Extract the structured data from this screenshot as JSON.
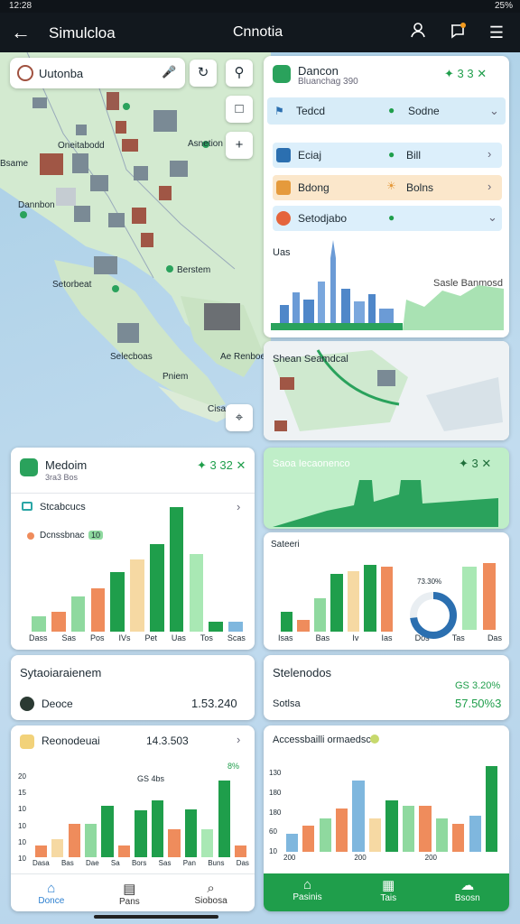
{
  "status": {
    "time": "12:28",
    "right": "25%"
  },
  "topbar": {
    "title": "Simulcloa",
    "center": "Cnnotia"
  },
  "search": {
    "value": "Uutonba"
  },
  "panel_top": {
    "title": "Dancon",
    "subtitle": "Bluanchag 390",
    "stat": "3 3",
    "rows": [
      {
        "left": "Tedcd",
        "right": "Sodne",
        "color": "#d7ecf8"
      },
      {
        "left": "Eciaj",
        "right": "Bill",
        "color": "#dceffb"
      },
      {
        "left": "Bdong",
        "right": "Bolns",
        "color": "#fbe7cb"
      },
      {
        "left": "Setodjabo",
        "right": "",
        "color": "#dceffb"
      }
    ],
    "label_left": "Uas",
    "label_right": "Sasle Banmosd"
  },
  "map_labels": {
    "a": "Oneitabodd",
    "b": "Asnetion",
    "c": "Bsame",
    "d": "Dannbon",
    "e": "Berstem",
    "f": "Setorbeat",
    "g": "Pniem",
    "h": "Selecboas",
    "i": "Cisamo",
    "j": "Ae Renboel"
  },
  "panel_map2": {
    "title": "Shean Seamdcal"
  },
  "panel_medium": {
    "title": "Medoim",
    "subtitle": "3ra3 Bos",
    "stat": "3 32",
    "row1": "Stcabcucs",
    "row2": "Dcnssbnac",
    "badge": "10",
    "xlabels": [
      "Dass",
      "Sas",
      "Pos",
      "IVs",
      "Pet",
      "Uas",
      "Tos",
      "Scas"
    ]
  },
  "chart_left": {
    "type": "bar",
    "values": [
      {
        "v": 12,
        "c": "#8fd99f"
      },
      {
        "v": 16,
        "c": "#ef8c5c"
      },
      {
        "v": 28,
        "c": "#8fd99f"
      },
      {
        "v": 35,
        "c": "#ef8c5c"
      },
      {
        "v": 48,
        "c": "#1f9e4b"
      },
      {
        "v": 58,
        "c": "#f6d9a3"
      },
      {
        "v": 70,
        "c": "#1f9e4b"
      },
      {
        "v": 100,
        "c": "#1f9e4b"
      },
      {
        "v": 62,
        "c": "#a9e8b4"
      },
      {
        "v": 8,
        "c": "#1f9e4b"
      },
      {
        "v": 8,
        "c": "#7fb7de"
      }
    ]
  },
  "panel_sust": {
    "title": "Sytaoiaraienem",
    "row": "Deoce",
    "value": "1.53.240"
  },
  "panel_research": {
    "title": "Reonodeuai",
    "value": "14.3.503",
    "badge": "8%",
    "ylabels": [
      "20",
      "15",
      "10",
      "10",
      "10",
      "10"
    ],
    "xlabels": [
      "Dasa",
      "Bas",
      "Dae",
      "Sa",
      "Bors",
      "Sas",
      "Pan",
      "Buns",
      "Das"
    ],
    "annot": "GS 4bs"
  },
  "chart_research": {
    "type": "bar",
    "values": [
      {
        "v": 14,
        "c": "#ef8c5c"
      },
      {
        "v": 22,
        "c": "#f6d9a3"
      },
      {
        "v": 40,
        "c": "#ef8c5c"
      },
      {
        "v": 40,
        "c": "#8fd99f"
      },
      {
        "v": 62,
        "c": "#1f9e4b"
      },
      {
        "v": 14,
        "c": "#ef8c5c"
      },
      {
        "v": 56,
        "c": "#1f9e4b"
      },
      {
        "v": 68,
        "c": "#1f9e4b"
      },
      {
        "v": 34,
        "c": "#ef8c5c"
      },
      {
        "v": 58,
        "c": "#1f9e4b"
      },
      {
        "v": 34,
        "c": "#a9e8b4"
      },
      {
        "v": 92,
        "c": "#1f9e4b"
      },
      {
        "v": 14,
        "c": "#ef8c5c"
      }
    ]
  },
  "panel_green": {
    "title": "Saoa Iecaonenco",
    "stat": "3"
  },
  "panel_dashboard": {
    "label": "Sateeri",
    "xlabels": [
      "Isas",
      "Bas",
      "Iv",
      "Ias",
      "Dos",
      "Tas",
      "Das"
    ],
    "pct": "73.30%"
  },
  "chart_dashboard": {
    "type": "bar",
    "values": [
      {
        "v": 28,
        "c": "#1f9e4b"
      },
      {
        "v": 16,
        "c": "#ef8c5c"
      },
      {
        "v": 46,
        "c": "#8fd99f"
      },
      {
        "v": 80,
        "c": "#1f9e4b"
      },
      {
        "v": 84,
        "c": "#f6d9a3"
      },
      {
        "v": 92,
        "c": "#1f9e4b"
      },
      {
        "v": 90,
        "c": "#ef8c5c"
      }
    ],
    "donut": 0.73
  },
  "panel_stats": {
    "title": "Stelenodos",
    "pct": "GS 3.20%",
    "row": "Sotlsa",
    "value": "57.50%3"
  },
  "panel_access": {
    "title": "Accessbailli ormaedsc",
    "ylabels": [
      "130",
      "180",
      "180",
      "60",
      "10"
    ],
    "xlabels": [
      "200",
      "200",
      "200"
    ]
  },
  "chart_access": {
    "type": "bar",
    "values": [
      {
        "v": 18,
        "c": "#7fb7de"
      },
      {
        "v": 26,
        "c": "#ef8c5c"
      },
      {
        "v": 34,
        "c": "#8fd99f"
      },
      {
        "v": 44,
        "c": "#ef8c5c"
      },
      {
        "v": 72,
        "c": "#7fb7de"
      },
      {
        "v": 34,
        "c": "#f6d9a3"
      },
      {
        "v": 52,
        "c": "#1f9e4b"
      },
      {
        "v": 46,
        "c": "#8fd99f"
      },
      {
        "v": 46,
        "c": "#ef8c5c"
      },
      {
        "v": 34,
        "c": "#8fd99f"
      },
      {
        "v": 28,
        "c": "#ef8c5c"
      },
      {
        "v": 36,
        "c": "#7fb7de"
      },
      {
        "v": 86,
        "c": "#1f9e4b"
      }
    ]
  },
  "bottom_nav": [
    {
      "label": "Donce",
      "icon": "home-icon"
    },
    {
      "label": "Pans",
      "icon": "document-icon"
    },
    {
      "label": "Siobosa",
      "icon": "search-icon"
    }
  ],
  "bottom_nav_right": [
    {
      "label": "Pasinis",
      "icon": "home-icon"
    },
    {
      "label": "Tais",
      "icon": "chart-icon"
    },
    {
      "label": "Bsosn",
      "icon": "cloud-icon"
    }
  ]
}
